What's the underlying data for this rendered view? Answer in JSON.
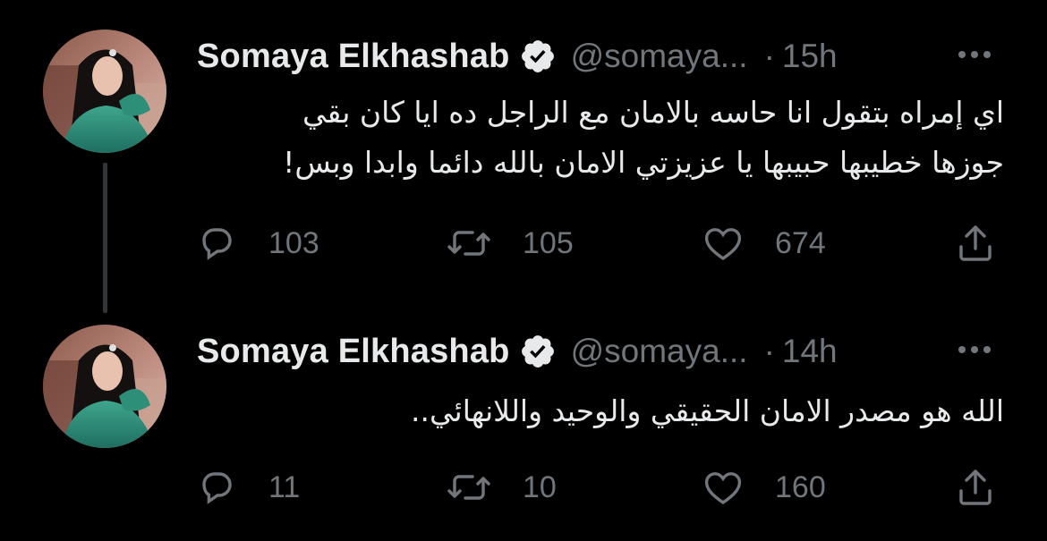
{
  "tweets": [
    {
      "display_name": "Somaya Elkhashab",
      "handle": "@somaya...",
      "separator": "·",
      "time": "15h",
      "text_line1": "اي إمراه بتقول انا حاسه بالامان مع الراجل ده ايا كان بقي",
      "text_line2": "جوزها خطيبها حبيبها يا عزيزتي الامان بالله دائما وابدا وبس!",
      "replies": "103",
      "retweets": "105",
      "likes": "674"
    },
    {
      "display_name": "Somaya Elkhashab",
      "handle": "@somaya...",
      "separator": "·",
      "time": "14h",
      "text_line1": "الله هو مصدر الامان الحقيقي والوحيد واللانهائي..",
      "replies": "11",
      "retweets": "10",
      "likes": "160"
    }
  ],
  "colors": {
    "background": "#000000",
    "primary_text": "#e7e9ea",
    "secondary_text": "#71767b",
    "thread_line": "#333639",
    "verified_badge": "#e7e9ea"
  },
  "icons": {
    "verified": "verified-badge-icon",
    "more": "more-options-icon",
    "reply": "reply-icon",
    "retweet": "retweet-icon",
    "like": "heart-icon",
    "share": "share-icon"
  }
}
